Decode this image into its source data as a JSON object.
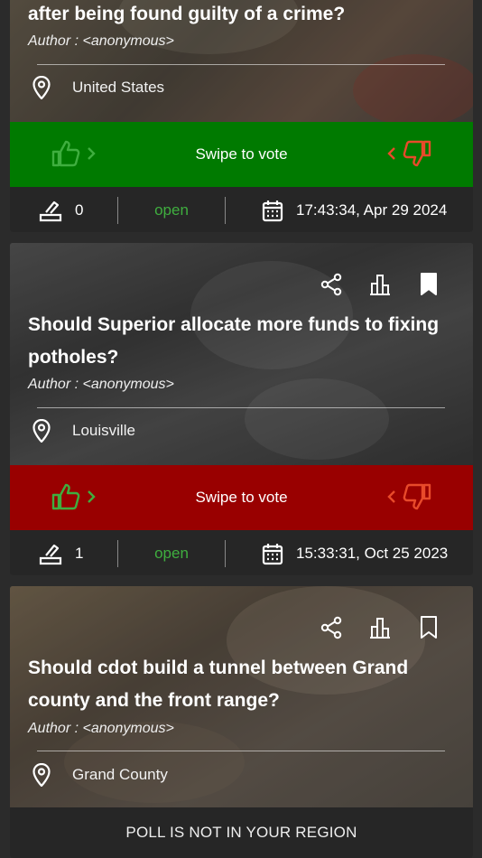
{
  "polls": [
    {
      "title": "after being found guilty of a crime?",
      "author": "Author : <anonymous>",
      "location": "United States",
      "swipe_label": "Swipe to vote",
      "vote_bar_color": "#007a00",
      "vote_count": "0",
      "status": "open",
      "datetime": "17:43:34, Apr 29 2024"
    },
    {
      "title": "Should Superior allocate more funds to fixing potholes?",
      "author": "Author : <anonymous>",
      "location": "Louisville",
      "swipe_label": "Swipe to vote",
      "vote_bar_color": "#990000",
      "vote_count": "1",
      "status": "open",
      "datetime": "15:33:31, Oct 25 2023",
      "bookmarked": true
    },
    {
      "title": "Should cdot build a tunnel between Grand county and the front range?",
      "author": "Author : <anonymous>",
      "location": "Grand County",
      "region_notice": "POLL IS NOT IN YOUR REGION",
      "bookmarked": false
    }
  ],
  "colors": {
    "up_icon": "#3fae3f",
    "down_icon": "#e84a2a",
    "status_open": "#3fae3f"
  },
  "icons": [
    "share-icon",
    "results-chart-icon",
    "bookmark-icon",
    "location-pin-icon",
    "thumbs-up-icon",
    "thumbs-down-icon",
    "ballot-box-icon",
    "calendar-icon"
  ]
}
